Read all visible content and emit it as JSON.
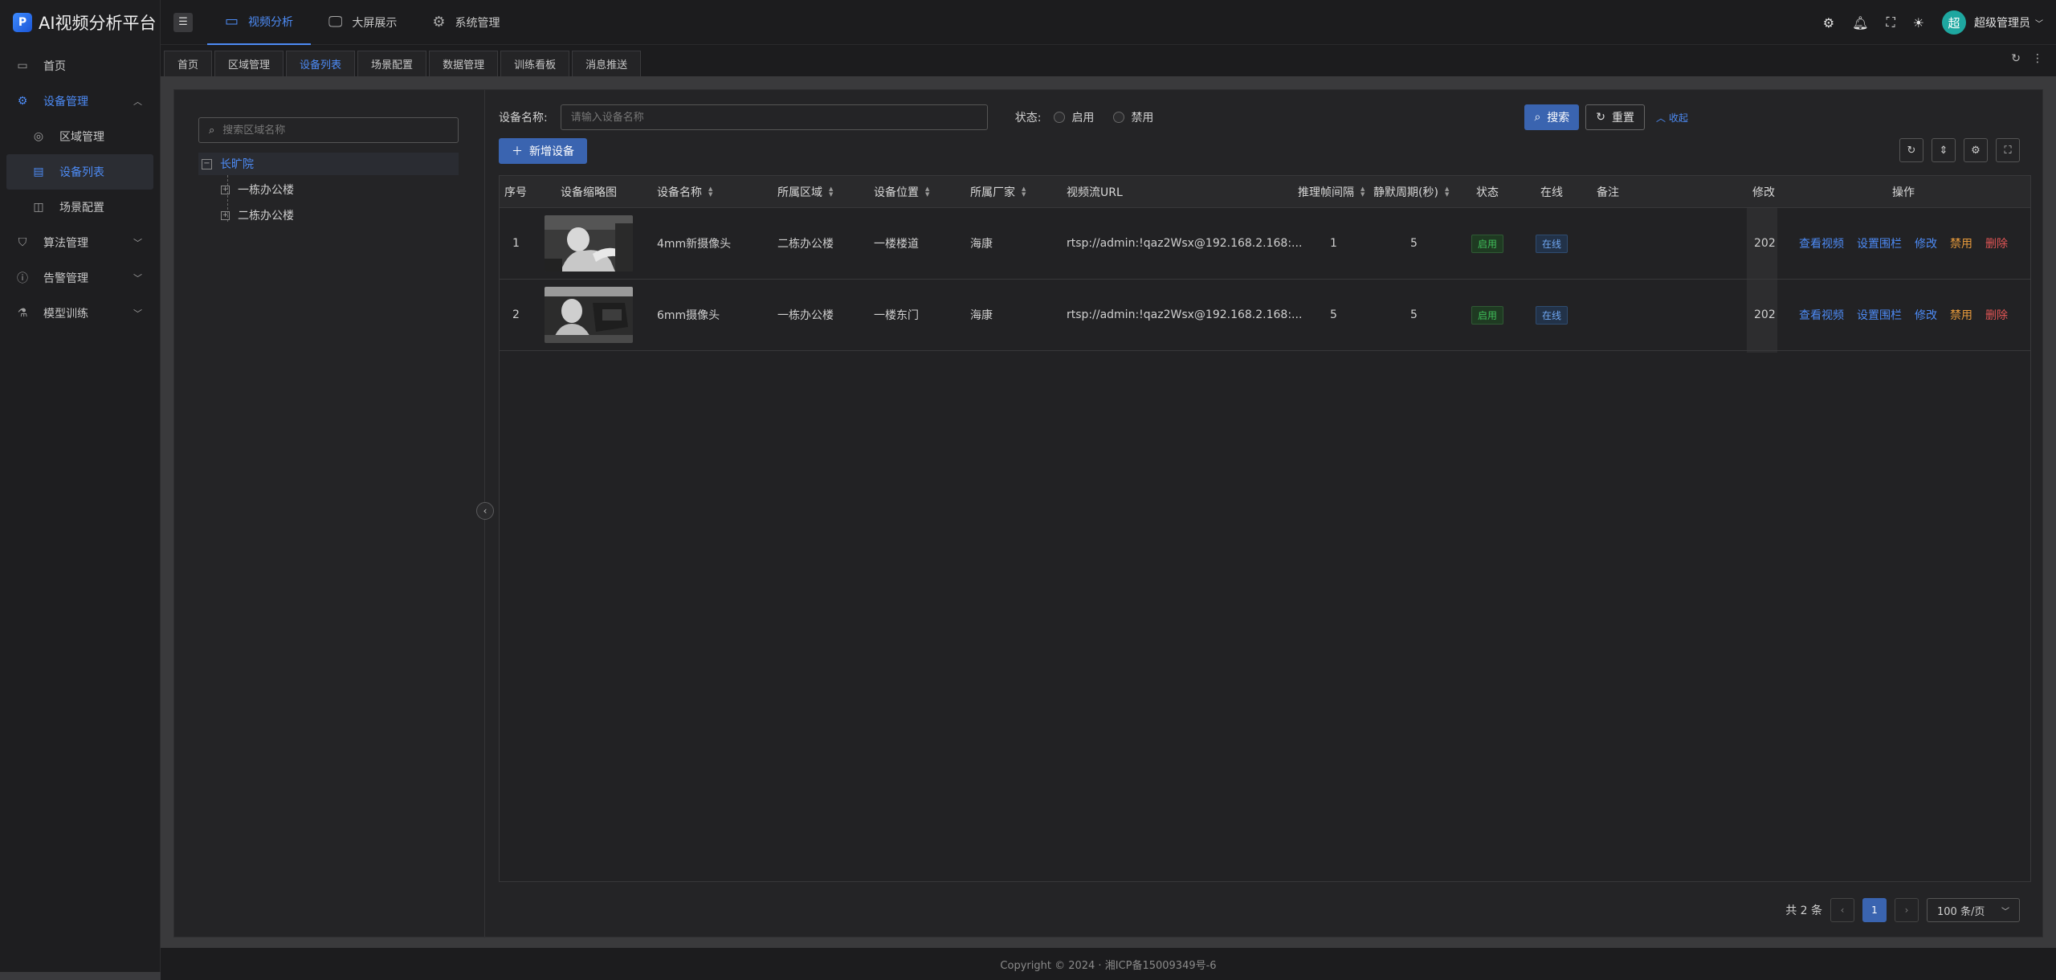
{
  "app": {
    "title": "AI视频分析平台",
    "logo_char": "P"
  },
  "sidebar": {
    "items": [
      {
        "label": "首页"
      },
      {
        "label": "设备管理"
      },
      {
        "label": "区域管理"
      },
      {
        "label": "设备列表"
      },
      {
        "label": "场景配置"
      },
      {
        "label": "算法管理"
      },
      {
        "label": "告警管理"
      },
      {
        "label": "模型训练"
      }
    ]
  },
  "topnav": {
    "items": [
      {
        "label": "视频分析"
      },
      {
        "label": "大屏展示"
      },
      {
        "label": "系统管理"
      }
    ],
    "avatar_char": "超",
    "user_name": "超级管理员"
  },
  "tabs": [
    "首页",
    "区域管理",
    "设备列表",
    "场景配置",
    "数据管理",
    "训练看板",
    "消息推送"
  ],
  "tree": {
    "search_placeholder": "搜索区域名称",
    "root": "长旷院",
    "children": [
      "一栋办公楼",
      "二栋办公楼"
    ]
  },
  "filter": {
    "name_label": "设备名称:",
    "name_placeholder": "请输入设备名称",
    "status_label": "状态:",
    "status_on": "启用",
    "status_off": "禁用",
    "search_btn": "搜索",
    "reset_btn": "重置",
    "collapse_link": "收起",
    "add_btn": "新增设备"
  },
  "table": {
    "headers": {
      "index": "序号",
      "thumb": "设备缩略图",
      "name": "设备名称",
      "area": "所属区域",
      "location": "设备位置",
      "vendor": "所属厂家",
      "url": "视频流URL",
      "interval": "推理帧间隔",
      "silent": "静默周期(秒)",
      "status": "状态",
      "online": "在线",
      "remark": "备注",
      "modified": "修改",
      "ops": "操作"
    },
    "rows": [
      {
        "index": "1",
        "name": "4mm新摄像头",
        "area": "二栋办公楼",
        "location": "一楼楼道",
        "vendor": "海康",
        "url": "rtsp://admin:!qaz2Wsx@192.168.2.168:...",
        "interval": "1",
        "silent": "5",
        "status": "启用",
        "online": "在线",
        "modified": "202"
      },
      {
        "index": "2",
        "name": "6mm摄像头",
        "area": "一栋办公楼",
        "location": "一楼东门",
        "vendor": "海康",
        "url": "rtsp://admin:!qaz2Wsx@192.168.2.168:...",
        "interval": "5",
        "silent": "5",
        "status": "启用",
        "online": "在线",
        "modified": "202"
      }
    ],
    "actions": {
      "view": "查看视频",
      "fence": "设置围栏",
      "edit": "修改",
      "disable": "禁用",
      "delete": "删除"
    }
  },
  "pagination": {
    "total": "共 2 条",
    "current": "1",
    "page_size": "100 条/页"
  },
  "footer": "Copyright © 2024 · 湘ICP备15009349号-6",
  "colors": {
    "accent": "#4d8bf5",
    "primary_btn": "#3a64b0",
    "warn": "#e79a3b",
    "danger": "#e05555"
  }
}
